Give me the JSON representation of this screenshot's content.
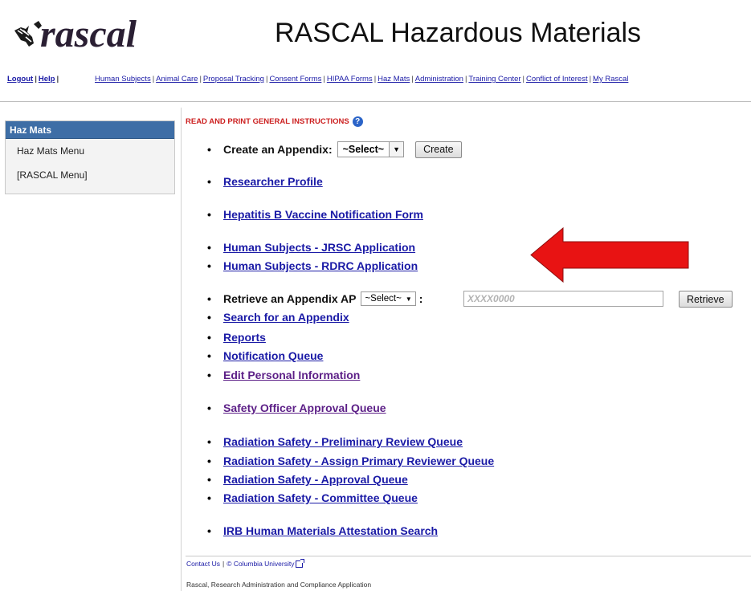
{
  "header": {
    "logo_text": "rascal",
    "title": "RASCAL Hazardous Materials"
  },
  "topnav": {
    "logout": "Logout",
    "help": "Help",
    "links": [
      "Human Subjects",
      "Animal Care",
      "Proposal Tracking",
      "Consent Forms",
      "HIPAA Forms",
      "Haz Mats",
      "Administration",
      "Training Center",
      "Conflict of Interest",
      "My Rascal"
    ]
  },
  "sidebar": {
    "header": "Haz Mats",
    "items": [
      "Haz Mats Menu",
      "[RASCAL Menu]"
    ]
  },
  "main": {
    "instructions": "READ AND PRINT GENERAL INSTRUCTIONS",
    "help_icon": "?",
    "create_appendix": {
      "label": "Create an Appendix:",
      "select_value": "~Select~",
      "button": "Create"
    },
    "researcher_profile": "Researcher Profile",
    "hepatitis": "Hepatitis B Vaccine Notification Form",
    "jrsc": "Human Subjects - JRSC Application",
    "rdrc": "Human Subjects - RDRC Application",
    "retrieve": {
      "label": "Retrieve an Appendix AP",
      "select_value": "~Select~",
      "colon": ":",
      "placeholder": "XXXX0000",
      "button": "Retrieve"
    },
    "search_appendix": "Search for an Appendix",
    "reports": "Reports",
    "notification_queue": "Notification Queue",
    "edit_personal": "Edit Personal Information",
    "safety_officer": "Safety Officer Approval Queue",
    "rad_prelim": "Radiation Safety - Preliminary Review Queue",
    "rad_assign": "Radiation Safety - Assign Primary Reviewer Queue",
    "rad_approval": "Radiation Safety - Approval Queue",
    "rad_committee": "Radiation Safety - Committee Queue",
    "irb_attestation": "IRB Human Materials Attestation Search"
  },
  "footer": {
    "contact": "Contact Us",
    "copyright": "© Columbia University",
    "description": "Rascal, Research Administration and Compliance Application"
  },
  "colors": {
    "link": "#1a1aa6",
    "visited_link": "#5c1f87",
    "sidebar_header": "#3e6ea6",
    "instructions": "#cc1f1f",
    "arrow": "#e81313"
  }
}
